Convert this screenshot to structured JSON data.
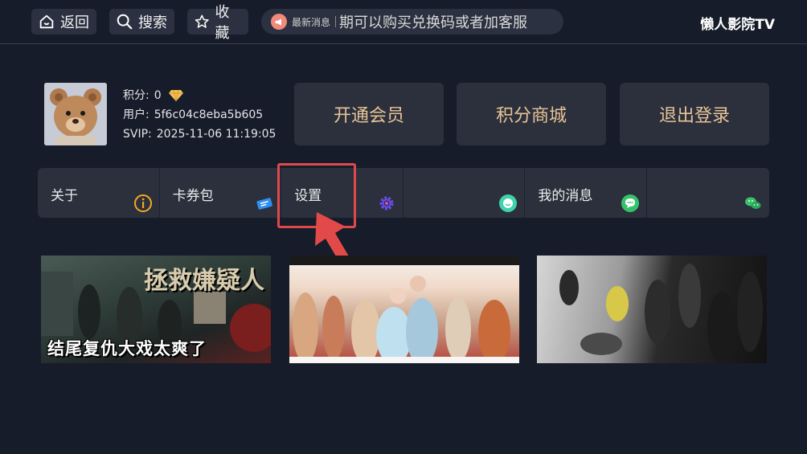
{
  "topbar": {
    "back_label": "返回",
    "search_label": "搜索",
    "favorite_label": "收藏",
    "news_label": "最新消息",
    "news_marquee": "期可以购买兑换码或者加客服",
    "app_title": "懒人影院TV"
  },
  "profile": {
    "points_key": "积分:",
    "points_value": "0",
    "user_key": "用户:",
    "user_value": "5f6c04c8eba5b605",
    "svip_key": "SVIP:",
    "svip_value": "2025-11-06 11:19:05"
  },
  "actions": {
    "vip_label": "开通会员",
    "mall_label": "积分商城",
    "logout_label": "退出登录"
  },
  "menu": {
    "items": [
      {
        "label": "关于",
        "icon": "info-icon"
      },
      {
        "label": "卡券包",
        "icon": "ticket-icon"
      },
      {
        "label": "设置",
        "icon": "gear-icon"
      },
      {
        "label": "",
        "icon": "chat-face-icon"
      },
      {
        "label": "我的消息",
        "icon": "message-icon"
      },
      {
        "label": "",
        "icon": "wechat-icon"
      }
    ]
  },
  "posters": {
    "p1_title": "拯救嫌疑人",
    "p1_caption": "结尾复仇大戏太爽了"
  },
  "colors": {
    "accent_gold": "#e8c397",
    "highlight_red": "#e0494b",
    "background": "#161c29"
  }
}
